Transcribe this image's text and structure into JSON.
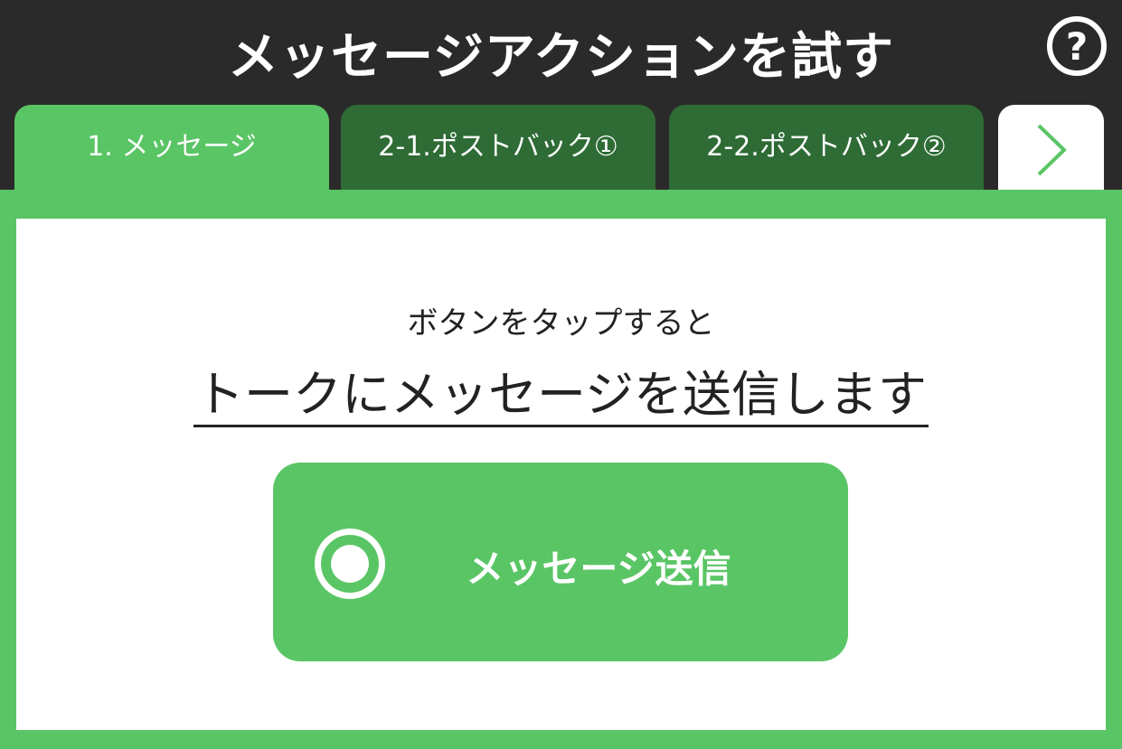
{
  "header": {
    "title": "メッセージアクションを試す",
    "help_label": "?"
  },
  "tabs": [
    {
      "label": "1. メッセージ",
      "active": true
    },
    {
      "label": "2-1.ポストバック①",
      "active": false
    },
    {
      "label": "2-2.ポストバック②",
      "active": false
    }
  ],
  "tab_next_icon": "chevron-right-icon",
  "content": {
    "subtitle": "ボタンをタップすると",
    "headline": "トークにメッセージを送信します",
    "button_label": "メッセージ送信",
    "button_icon": "radio-icon"
  },
  "colors": {
    "accent": "#5ac565",
    "dark_tab": "#2e6b35",
    "header_bg": "#2a2a2a"
  }
}
